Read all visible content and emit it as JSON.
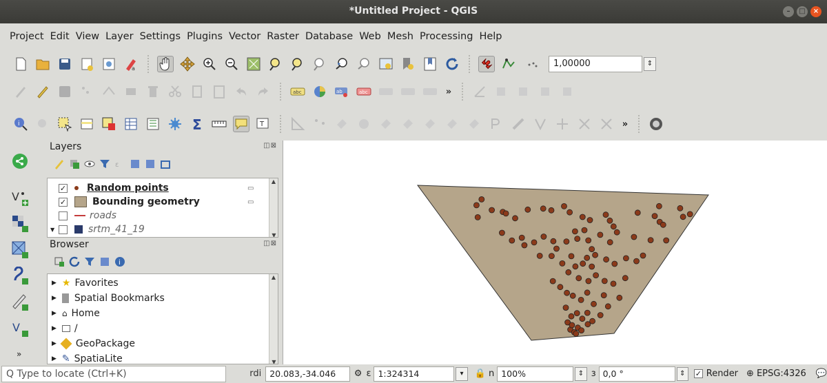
{
  "window": {
    "title": "*Untitled Project - QGIS"
  },
  "menu": [
    "Project",
    "Edit",
    "View",
    "Layer",
    "Settings",
    "Plugins",
    "Vector",
    "Raster",
    "Database",
    "Web",
    "Mesh",
    "Processing",
    "Help"
  ],
  "toolbar": {
    "snap_tolerance": "1,00000",
    "more": "»"
  },
  "layers_panel": {
    "title": "Layers",
    "items": [
      {
        "label": "Random points",
        "checked": true,
        "bold": true,
        "underline": true,
        "symbol": "point",
        "color": "#8b3a1a"
      },
      {
        "label": "Bounding geometry",
        "checked": true,
        "bold": true,
        "symbol": "fill",
        "color": "#b5a58a"
      },
      {
        "label": "roads",
        "checked": false,
        "italic": true,
        "symbol": "line",
        "color": "#c43c3c"
      },
      {
        "label": "srtm_41_19",
        "checked": false,
        "italic": true,
        "symbol": "raster"
      }
    ]
  },
  "browser_panel": {
    "title": "Browser",
    "items": [
      {
        "label": "Favorites",
        "icon": "star-icon"
      },
      {
        "label": "Spatial Bookmarks",
        "icon": "bookmark-icon"
      },
      {
        "label": "Home",
        "icon": "home-icon"
      },
      {
        "label": "/",
        "icon": "folder-icon"
      },
      {
        "label": "GeoPackage",
        "icon": "geopackage-icon"
      },
      {
        "label": "SpatiaLite",
        "icon": "spatialite-icon"
      }
    ]
  },
  "map": {
    "fill_color": "#b5a58a",
    "point_color": "#8b3a1a",
    "points": [
      [
        0.2,
        0.08
      ],
      [
        0.17,
        0.12
      ],
      [
        0.22,
        0.15
      ],
      [
        0.26,
        0.16
      ],
      [
        0.27,
        0.17
      ],
      [
        0.3,
        0.2
      ],
      [
        0.36,
        0.14
      ],
      [
        0.42,
        0.13
      ],
      [
        0.45,
        0.14
      ],
      [
        0.5,
        0.11
      ],
      [
        0.52,
        0.15
      ],
      [
        0.57,
        0.18
      ],
      [
        0.6,
        0.2
      ],
      [
        0.66,
        0.16
      ],
      [
        0.68,
        0.2
      ],
      [
        0.7,
        0.24
      ],
      [
        0.78,
        0.14
      ],
      [
        0.85,
        0.16
      ],
      [
        0.88,
        0.2
      ],
      [
        0.9,
        0.22
      ],
      [
        0.96,
        0.16
      ],
      [
        0.98,
        0.14
      ],
      [
        0.93,
        0.1
      ],
      [
        0.85,
        0.09
      ],
      [
        0.15,
        0.2
      ],
      [
        0.22,
        0.3
      ],
      [
        0.25,
        0.35
      ],
      [
        0.3,
        0.33
      ],
      [
        0.35,
        0.36
      ],
      [
        0.4,
        0.32
      ],
      [
        0.44,
        0.35
      ],
      [
        0.5,
        0.35
      ],
      [
        0.55,
        0.33
      ],
      [
        0.6,
        0.34
      ],
      [
        0.65,
        0.3
      ],
      [
        0.7,
        0.35
      ],
      [
        0.72,
        0.28
      ],
      [
        0.8,
        0.31
      ],
      [
        0.88,
        0.33
      ],
      [
        0.95,
        0.33
      ],
      [
        0.3,
        0.38
      ],
      [
        0.36,
        0.45
      ],
      [
        0.42,
        0.45
      ],
      [
        0.47,
        0.5
      ],
      [
        0.52,
        0.45
      ],
      [
        0.54,
        0.52
      ],
      [
        0.58,
        0.5
      ],
      [
        0.63,
        0.52
      ],
      [
        0.7,
        0.47
      ],
      [
        0.75,
        0.5
      ],
      [
        0.8,
        0.46
      ],
      [
        0.86,
        0.48
      ],
      [
        0.88,
        0.44
      ],
      [
        0.45,
        0.4
      ],
      [
        0.5,
        0.56
      ],
      [
        0.56,
        0.6
      ],
      [
        0.62,
        0.62
      ],
      [
        0.66,
        0.58
      ],
      [
        0.72,
        0.62
      ],
      [
        0.78,
        0.64
      ],
      [
        0.84,
        0.6
      ],
      [
        0.4,
        0.62
      ],
      [
        0.44,
        0.66
      ],
      [
        0.48,
        0.7
      ],
      [
        0.52,
        0.72
      ],
      [
        0.58,
        0.75
      ],
      [
        0.62,
        0.7
      ],
      [
        0.68,
        0.78
      ],
      [
        0.74,
        0.72
      ],
      [
        0.8,
        0.8
      ],
      [
        0.86,
        0.74
      ],
      [
        0.46,
        0.8
      ],
      [
        0.5,
        0.86
      ],
      [
        0.55,
        0.84
      ],
      [
        0.6,
        0.88
      ],
      [
        0.64,
        0.84
      ],
      [
        0.48,
        0.95
      ],
      [
        0.52,
        0.97
      ],
      [
        0.56,
        0.94
      ],
      [
        0.6,
        0.96
      ],
      [
        0.66,
        0.92
      ],
      [
        0.7,
        0.9
      ],
      [
        0.46,
        0.9
      ],
      [
        0.5,
        0.92
      ],
      [
        0.54,
        0.98
      ],
      [
        0.76,
        0.86
      ],
      [
        0.54,
        0.28
      ],
      [
        0.58,
        0.27
      ],
      [
        0.62,
        0.4
      ],
      [
        0.6,
        0.46
      ],
      [
        0.64,
        0.44
      ]
    ]
  },
  "status": {
    "locate_placeholder": "Q Type to locate (Ctrl+K)",
    "coord_label": "rdi",
    "coordinate": "20.083,-34.046",
    "scale_label": "ε",
    "scale": "1:324314",
    "magnifier_label": "n",
    "magnifier": "100%",
    "rotation_label": "ɜ",
    "rotation": "0,0 °",
    "render_label": "Render",
    "crs": "EPSG:4326"
  }
}
